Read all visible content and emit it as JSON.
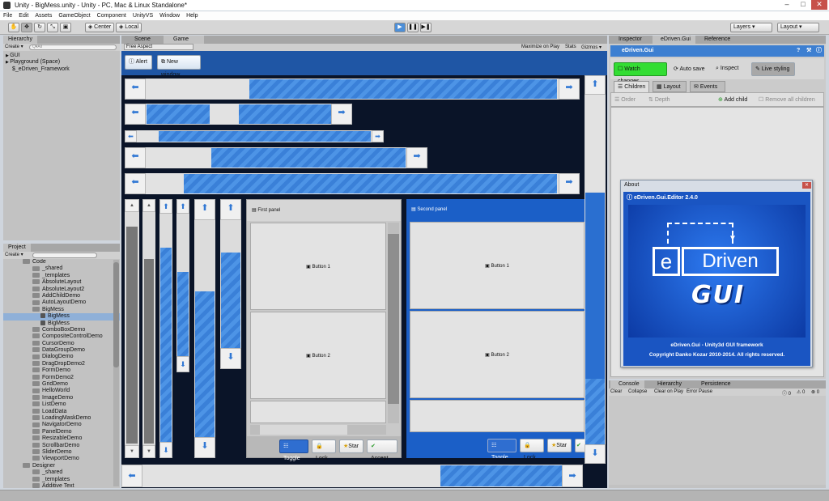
{
  "window": {
    "title": "Unity - BigMess.unity - Unity - PC, Mac & Linux Standalone*",
    "min": "–",
    "max": "□",
    "close": "✕"
  },
  "menu": [
    "File",
    "Edit",
    "Assets",
    "GameObject",
    "Component",
    "UnityVS",
    "Window",
    "Help"
  ],
  "toolbar": {
    "center": "Center",
    "local": "Local",
    "layers": "Layers",
    "layout": "Layout"
  },
  "hierarchy": {
    "tab": "Hierarchy",
    "create": "Create ▾",
    "search": "Q▾All",
    "items": [
      "GUI",
      "Playground (Space)",
      "$_eDriven_Framework"
    ]
  },
  "project": {
    "tab": "Project",
    "create": "Create ▾",
    "items": [
      "Code",
      "_shared",
      "_templates",
      "AbsoluteLayout",
      "AbsoluteLayout2",
      "AddChildDemo",
      "AutoLayoutDemo",
      "BigMess",
      "BigMess",
      "BigMess",
      "ComboBoxDemo",
      "CompositeControlDemo",
      "CursorDemo",
      "DataGroupDemo",
      "DialogDemo",
      "DragDropDemo2",
      "FormDemo",
      "FormDemo2",
      "GridDemo",
      "HelloWorld",
      "ImageDemo",
      "ListDemo",
      "LoadData",
      "LoadingMaskDemo",
      "NavigatorDemo",
      "PanelDemo",
      "ResizableDemo",
      "ScrollbarDemo",
      "SliderDemo",
      "ViewportDemo",
      "Designer",
      "_shared",
      "_templates",
      "Additive Text"
    ]
  },
  "game": {
    "tabs": [
      "Scene",
      "Game"
    ],
    "aspect": "Free Aspect",
    "maximize": "Maximize on Play",
    "stats": "Stats",
    "gizmos": "Gizmos ▾",
    "alert": "Alert",
    "new_window": "New window"
  },
  "panels": {
    "first": {
      "title": "First panel",
      "btn1": "Button 1",
      "btn2": "Button 2"
    },
    "second": {
      "title": "Second panel",
      "btn1": "Button 1",
      "btn2": "Button 2"
    },
    "buttons": [
      "Toggle",
      "Lock",
      "Star",
      "Accept"
    ]
  },
  "inspector": {
    "tabs": [
      "Inspector",
      "eDriven.Gui",
      "Reference"
    ],
    "title": "eDriven.Gui",
    "watch": "Watch changes",
    "autosave": "Auto save",
    "inspect": "Inspect",
    "live": "Live styling",
    "subtabs": [
      "Children",
      "Layout",
      "Events"
    ],
    "order": "Order",
    "depth": "Depth",
    "add_child": "Add child",
    "remove_all": "Remove all children"
  },
  "about": {
    "title": "About",
    "version": "eDriven.Gui.Editor 2.4.0",
    "logo_e": "e",
    "logo_driven": "Driven",
    "logo_gui": "GUI",
    "line1": "eDriven.Gui - Unity3d GUI framework",
    "line2": "Copyright Danko Kozar 2010-2014. All rights reserved."
  },
  "console": {
    "tabs": [
      "Console",
      "Hierarchy",
      "Persistence"
    ],
    "buttons": [
      "Clear",
      "Collapse",
      "Clear on Play",
      "Error Pause"
    ],
    "counts": [
      "0",
      "0",
      "0"
    ]
  },
  "colors": {
    "accent": "#3a80d8",
    "watch": "#33dd33",
    "header": "#3d7fd1"
  }
}
